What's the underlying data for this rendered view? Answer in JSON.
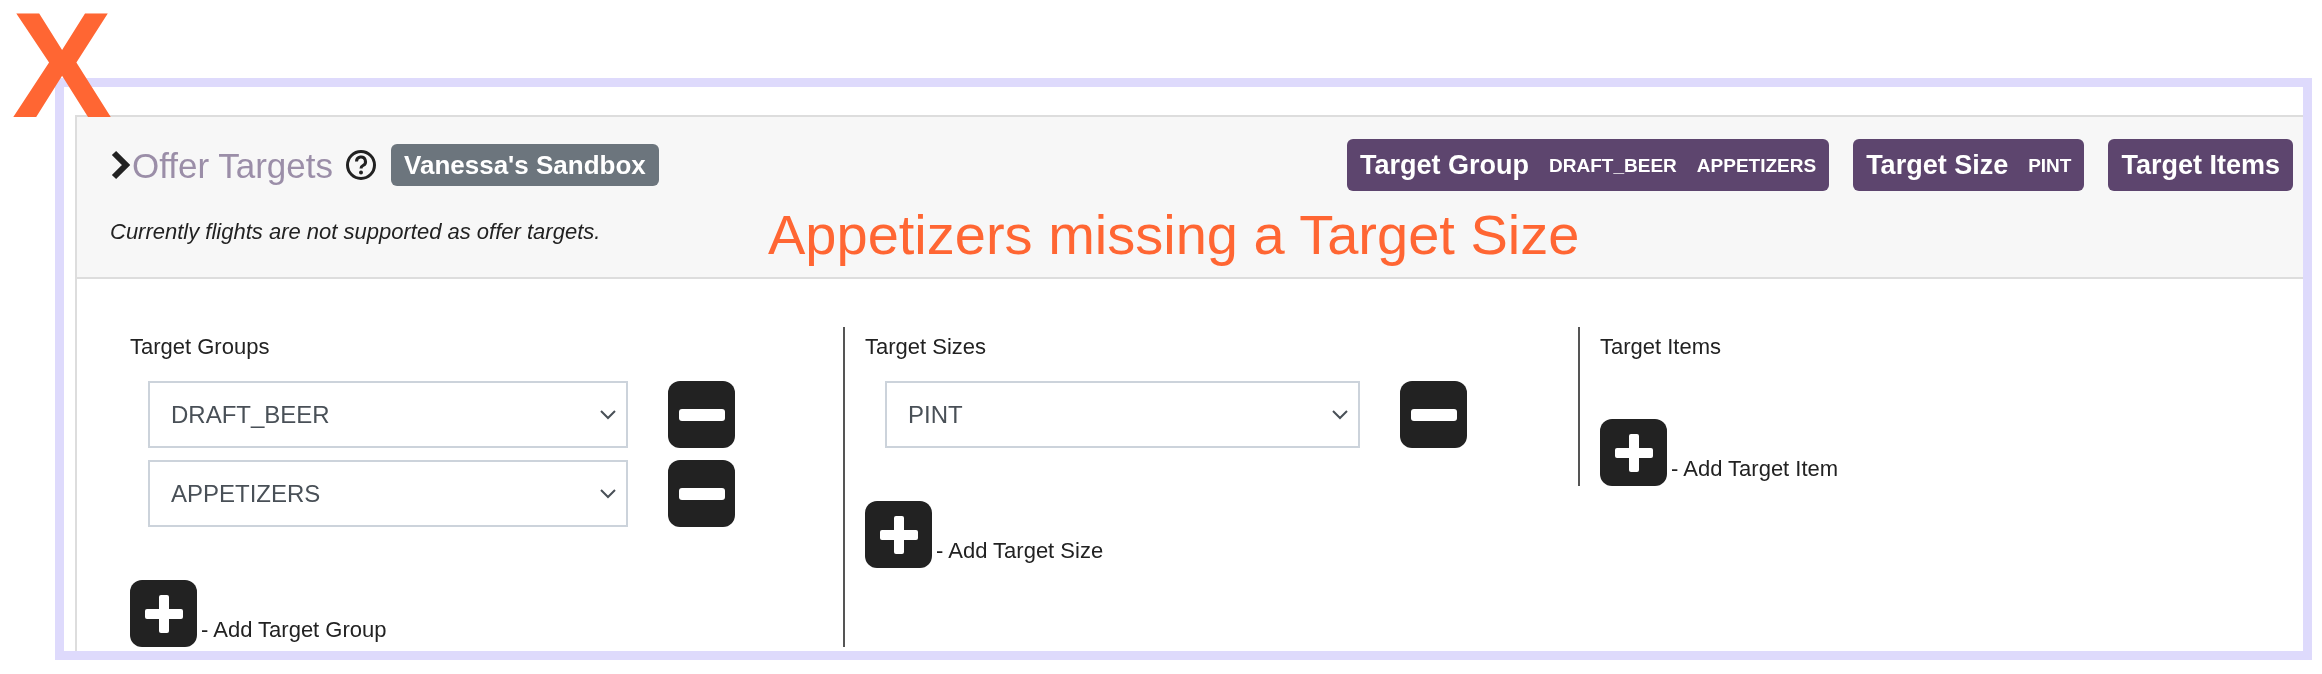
{
  "annotation_mark": "X",
  "annotation": "Appetizers missing a Target Size",
  "panel": {
    "title": "Offer Targets",
    "sandbox_badge": "Vanessa's Sandbox",
    "note": "Currently flights are not supported as offer targets.",
    "summary_badges": [
      {
        "label": "Target Group",
        "values": [
          "DRAFT_BEER",
          "APPETIZERS"
        ]
      },
      {
        "label": "Target Size",
        "values": [
          "PINT"
        ]
      },
      {
        "label": "Target Items"
      }
    ]
  },
  "sections": [
    {
      "label": "Target Groups",
      "selects": [
        {
          "value": "DRAFT_BEER"
        },
        {
          "value": "APPETIZERS"
        }
      ],
      "add_label": "- Add Target Group"
    },
    {
      "label": "Target Sizes",
      "selects": [
        {
          "value": "PINT"
        }
      ],
      "add_label": "- Add Target Size"
    },
    {
      "label": "Target Items",
      "add_label": "- Add Target Item"
    }
  ]
}
